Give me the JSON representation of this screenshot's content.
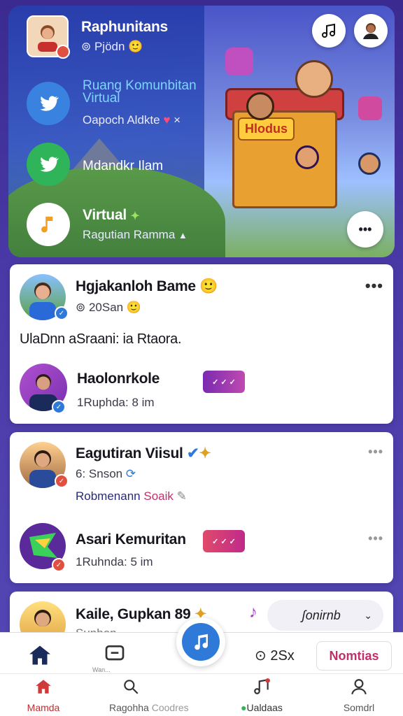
{
  "hero": {
    "items": [
      {
        "title": "Raphunitans",
        "subtitle": "⊚ Pjödn 🙂"
      },
      {
        "title": "Ruang Komunbitan Virtual",
        "subtitle": "Oapoch Aldkte",
        "subtitle_mark": "×"
      },
      {
        "title": "Mdandkr Ilam",
        "subtitle": ""
      },
      {
        "title": "Virtual",
        "subtitle": "Ragutian Ramma"
      }
    ],
    "scene_sign": "Hlodus",
    "music_button": "music-note",
    "more_button": "•••"
  },
  "cards": [
    {
      "title": "Hgjakanloh Bame",
      "emoji": "🙂",
      "meta": "⊚ 20San 🙂",
      "body": "UlaDnn aSraani: ia Rtaora.",
      "more": "•••",
      "sub_item": {
        "title": "Haolonrkole",
        "meta": "1Ruphda: 8 im",
        "sticker": "✓ ✓ ✓"
      }
    },
    {
      "title": "Eagutiran Viisul",
      "meta": "6: Snson",
      "link_prefix": "Robmenann",
      "link": "Soaik",
      "more": "•••",
      "sub_item": {
        "title": "Asari Kemuritan",
        "meta": "1Ruhnda: 5 im",
        "sticker": "✓ ✓ ✓",
        "more": "•••"
      }
    },
    {
      "title": "Kaile, Gupkan 89",
      "meta": "Sunhon",
      "dropdown": "ʃonirnb"
    }
  ],
  "action_bar": {
    "chat_icon": "chat-icon",
    "play_icon": "music-note",
    "counter": "⊙ 2Sx",
    "button": "Nomtias",
    "chat_label": "Wan..."
  },
  "bottom_nav": [
    {
      "label": "Mamda",
      "icon": "home-icon"
    },
    {
      "label": "Ragohha",
      "icon": "search-icon"
    },
    {
      "label": "Coodres",
      "icon": ""
    },
    {
      "label": "Ualdaas",
      "icon": "music-icon"
    },
    {
      "label": "Somdrl",
      "icon": "profile-icon"
    }
  ],
  "colors": {
    "accent": "#2f7ad8",
    "pink": "#c0306a",
    "nav_red": "#d03a3a"
  }
}
